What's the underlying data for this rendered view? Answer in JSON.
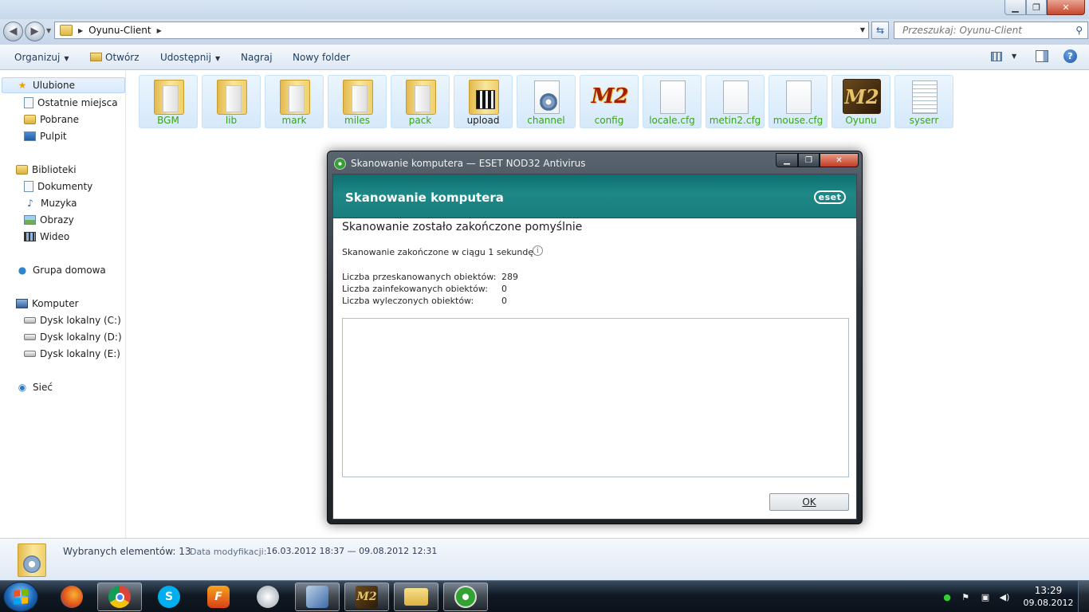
{
  "window": {
    "minimize_glyph": "▁",
    "maximize_glyph": "❐",
    "close_glyph": "✕"
  },
  "navbar": {
    "back_glyph": "◀",
    "forward_glyph": "▶",
    "address_folder": "Oyunu-Client",
    "refresh_glyph": "⇆",
    "search_placeholder": "Przeszukaj: Oyunu-Client",
    "search_icon": "search-icon"
  },
  "toolbar": {
    "organize": "Organizuj",
    "open": "Otwórz",
    "share": "Udostępnij",
    "burn": "Nagraj",
    "new_folder": "Nowy folder",
    "help": "?"
  },
  "navpane": {
    "favorites": "Ulubione",
    "recent": "Ostatnie miejsca",
    "downloads": "Pobrane",
    "desktop": "Pulpit",
    "libraries": "Biblioteki",
    "documents": "Dokumenty",
    "music": "Muzyka",
    "pictures": "Obrazy",
    "videos": "Wideo",
    "homegroup": "Grupa domowa",
    "computer": "Komputer",
    "drive_c": "Dysk lokalny (C:)",
    "drive_d": "Dysk lokalny (D:)",
    "drive_e": "Dysk lokalny (E:)",
    "network": "Sieć"
  },
  "files": [
    {
      "name": "BGM",
      "icon": "folder-icon"
    },
    {
      "name": "lib",
      "icon": "folder-icon"
    },
    {
      "name": "mark",
      "icon": "folder-icon"
    },
    {
      "name": "miles",
      "icon": "folder-icon"
    },
    {
      "name": "pack",
      "icon": "folder-icon"
    },
    {
      "name": "upload",
      "icon": "folder-icon"
    },
    {
      "name": "channel",
      "icon": "settings-file-icon"
    },
    {
      "name": "config",
      "icon": "metin2-icon"
    },
    {
      "name": "locale.cfg",
      "icon": "file-icon"
    },
    {
      "name": "metin2.cfg",
      "icon": "file-icon"
    },
    {
      "name": "mouse.cfg",
      "icon": "file-icon"
    },
    {
      "name": "Oyunu",
      "icon": "metin2-app-icon"
    },
    {
      "name": "syserr",
      "icon": "text-file-icon"
    }
  ],
  "details": {
    "selected": "Wybranych elementów: 13",
    "date_label": "Data modyfikacji:",
    "date_range": "16.03.2012 18:37 — 09.08.2012 12:31"
  },
  "dialog": {
    "window_title": "Skanowanie komputera — ESET NOD32 Antivirus",
    "header_title": "Skanowanie komputera",
    "logo_text": "eset",
    "status": "Skanowanie zostało zakończone pomyślnie",
    "duration": "Skanowanie zakończone w ciągu 1 sekundę.",
    "info_glyph": "i",
    "stats": [
      {
        "label": "Liczba przeskanowanych obiektów:",
        "value": "289"
      },
      {
        "label": "Liczba zainfekowanych obiektów:",
        "value": "0"
      },
      {
        "label": "Liczba wyleczonych obiektów:",
        "value": "0"
      }
    ],
    "ok_label": "OK"
  },
  "taskbar": {
    "apps": [
      "firefox-icon",
      "chrome-icon",
      "skype-icon",
      "flash-icon",
      "vmware-icon",
      "virtualbox-icon",
      "metin2-icon",
      "explorer-icon",
      "eset-icon"
    ],
    "clock_time": "13:29",
    "clock_date": "09.08.2012"
  },
  "colors": {
    "eset_teal": "#1a7d7c",
    "file_label_green": "#3aa21c",
    "taskbar_dark": "#101a24"
  }
}
